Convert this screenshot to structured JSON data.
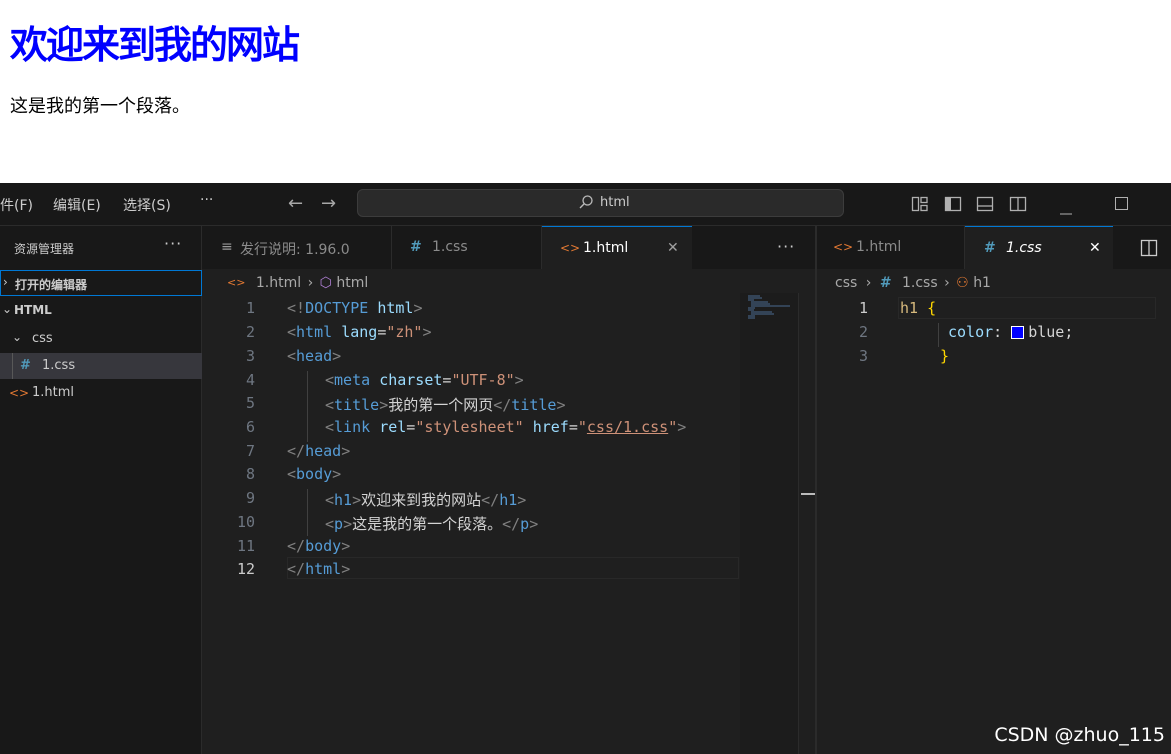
{
  "preview": {
    "heading": "欢迎来到我的网站",
    "paragraph": "这是我的第一个段落。"
  },
  "menu": [
    "件(F)",
    "编辑(E)",
    "选择(S)",
    "···"
  ],
  "command_center": {
    "text": "html"
  },
  "explorer": {
    "title": "资源管理器",
    "more": "···",
    "open_editors": "打开的编辑器",
    "workspace": "HTML",
    "items": [
      {
        "label": "css",
        "type": "folder"
      },
      {
        "label": "1.css",
        "type": "file-css"
      },
      {
        "label": "1.html",
        "type": "file-html"
      }
    ]
  },
  "left_tabs": [
    {
      "label": "发行说明: 1.96.0",
      "icon": "release-notes-icon"
    },
    {
      "label": "1.css",
      "icon": "css-file-icon"
    },
    {
      "label": "1.html",
      "icon": "html-file-icon",
      "active": true,
      "close": "✕"
    }
  ],
  "left_tab_more": "···",
  "left_breadcrumb": {
    "file": "1.html",
    "symbol": "html"
  },
  "left_code": {
    "line_numbers": [
      "1",
      "2",
      "3",
      "4",
      "5",
      "6",
      "7",
      "8",
      "9",
      "10",
      "11",
      "12"
    ]
  },
  "right_tabs": [
    {
      "label": "1.html",
      "icon": "html-file-icon"
    },
    {
      "label": "1.css",
      "icon": "css-file-icon",
      "active": true,
      "close": "✕"
    }
  ],
  "right_breadcrumb": {
    "folder": "css",
    "file": "1.css",
    "symbol": "h1"
  },
  "right_code": {
    "line_numbers": [
      "1",
      "2",
      "3"
    ],
    "selector": "h1",
    "open_brace": "{",
    "property": "color",
    "colon": ":",
    "value": "blue;",
    "close_brace": "}"
  },
  "colors": {
    "swatch": "#0000ff",
    "accent_orange": "#e37933",
    "css_blue": "#519aba"
  },
  "watermark": "CSDN @zhuo_115"
}
